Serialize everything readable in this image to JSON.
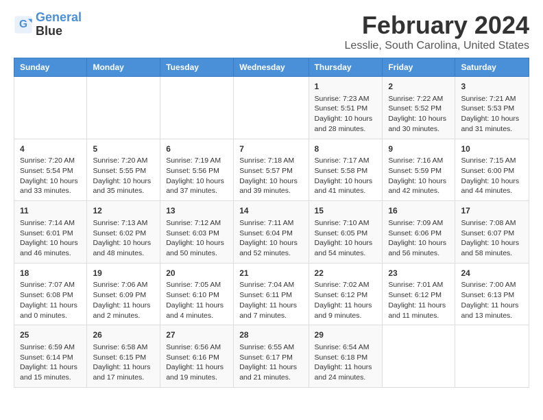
{
  "logo": {
    "line1": "General",
    "line2": "Blue"
  },
  "title": "February 2024",
  "subtitle": "Lesslie, South Carolina, United States",
  "days_of_week": [
    "Sunday",
    "Monday",
    "Tuesday",
    "Wednesday",
    "Thursday",
    "Friday",
    "Saturday"
  ],
  "weeks": [
    [
      {
        "day": "",
        "info": ""
      },
      {
        "day": "",
        "info": ""
      },
      {
        "day": "",
        "info": ""
      },
      {
        "day": "",
        "info": ""
      },
      {
        "day": "1",
        "info": "Sunrise: 7:23 AM\nSunset: 5:51 PM\nDaylight: 10 hours and 28 minutes."
      },
      {
        "day": "2",
        "info": "Sunrise: 7:22 AM\nSunset: 5:52 PM\nDaylight: 10 hours and 30 minutes."
      },
      {
        "day": "3",
        "info": "Sunrise: 7:21 AM\nSunset: 5:53 PM\nDaylight: 10 hours and 31 minutes."
      }
    ],
    [
      {
        "day": "4",
        "info": "Sunrise: 7:20 AM\nSunset: 5:54 PM\nDaylight: 10 hours and 33 minutes."
      },
      {
        "day": "5",
        "info": "Sunrise: 7:20 AM\nSunset: 5:55 PM\nDaylight: 10 hours and 35 minutes."
      },
      {
        "day": "6",
        "info": "Sunrise: 7:19 AM\nSunset: 5:56 PM\nDaylight: 10 hours and 37 minutes."
      },
      {
        "day": "7",
        "info": "Sunrise: 7:18 AM\nSunset: 5:57 PM\nDaylight: 10 hours and 39 minutes."
      },
      {
        "day": "8",
        "info": "Sunrise: 7:17 AM\nSunset: 5:58 PM\nDaylight: 10 hours and 41 minutes."
      },
      {
        "day": "9",
        "info": "Sunrise: 7:16 AM\nSunset: 5:59 PM\nDaylight: 10 hours and 42 minutes."
      },
      {
        "day": "10",
        "info": "Sunrise: 7:15 AM\nSunset: 6:00 PM\nDaylight: 10 hours and 44 minutes."
      }
    ],
    [
      {
        "day": "11",
        "info": "Sunrise: 7:14 AM\nSunset: 6:01 PM\nDaylight: 10 hours and 46 minutes."
      },
      {
        "day": "12",
        "info": "Sunrise: 7:13 AM\nSunset: 6:02 PM\nDaylight: 10 hours and 48 minutes."
      },
      {
        "day": "13",
        "info": "Sunrise: 7:12 AM\nSunset: 6:03 PM\nDaylight: 10 hours and 50 minutes."
      },
      {
        "day": "14",
        "info": "Sunrise: 7:11 AM\nSunset: 6:04 PM\nDaylight: 10 hours and 52 minutes."
      },
      {
        "day": "15",
        "info": "Sunrise: 7:10 AM\nSunset: 6:05 PM\nDaylight: 10 hours and 54 minutes."
      },
      {
        "day": "16",
        "info": "Sunrise: 7:09 AM\nSunset: 6:06 PM\nDaylight: 10 hours and 56 minutes."
      },
      {
        "day": "17",
        "info": "Sunrise: 7:08 AM\nSunset: 6:07 PM\nDaylight: 10 hours and 58 minutes."
      }
    ],
    [
      {
        "day": "18",
        "info": "Sunrise: 7:07 AM\nSunset: 6:08 PM\nDaylight: 11 hours and 0 minutes."
      },
      {
        "day": "19",
        "info": "Sunrise: 7:06 AM\nSunset: 6:09 PM\nDaylight: 11 hours and 2 minutes."
      },
      {
        "day": "20",
        "info": "Sunrise: 7:05 AM\nSunset: 6:10 PM\nDaylight: 11 hours and 4 minutes."
      },
      {
        "day": "21",
        "info": "Sunrise: 7:04 AM\nSunset: 6:11 PM\nDaylight: 11 hours and 7 minutes."
      },
      {
        "day": "22",
        "info": "Sunrise: 7:02 AM\nSunset: 6:12 PM\nDaylight: 11 hours and 9 minutes."
      },
      {
        "day": "23",
        "info": "Sunrise: 7:01 AM\nSunset: 6:12 PM\nDaylight: 11 hours and 11 minutes."
      },
      {
        "day": "24",
        "info": "Sunrise: 7:00 AM\nSunset: 6:13 PM\nDaylight: 11 hours and 13 minutes."
      }
    ],
    [
      {
        "day": "25",
        "info": "Sunrise: 6:59 AM\nSunset: 6:14 PM\nDaylight: 11 hours and 15 minutes."
      },
      {
        "day": "26",
        "info": "Sunrise: 6:58 AM\nSunset: 6:15 PM\nDaylight: 11 hours and 17 minutes."
      },
      {
        "day": "27",
        "info": "Sunrise: 6:56 AM\nSunset: 6:16 PM\nDaylight: 11 hours and 19 minutes."
      },
      {
        "day": "28",
        "info": "Sunrise: 6:55 AM\nSunset: 6:17 PM\nDaylight: 11 hours and 21 minutes."
      },
      {
        "day": "29",
        "info": "Sunrise: 6:54 AM\nSunset: 6:18 PM\nDaylight: 11 hours and 24 minutes."
      },
      {
        "day": "",
        "info": ""
      },
      {
        "day": "",
        "info": ""
      }
    ]
  ]
}
